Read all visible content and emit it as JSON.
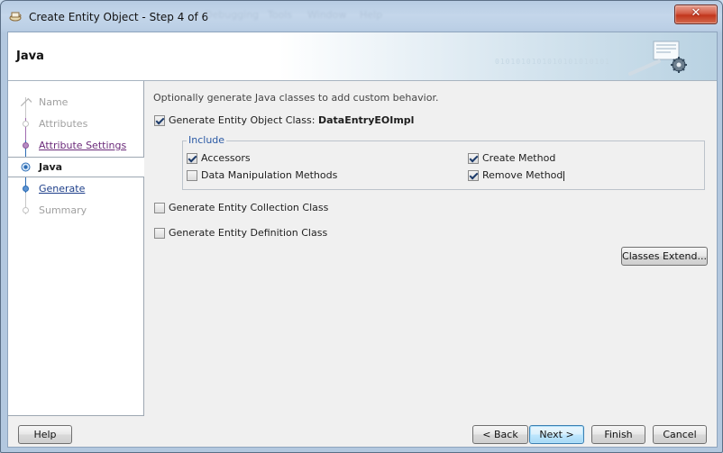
{
  "window": {
    "title": "Create Entity Object - Step 4 of 6",
    "ghost_menu": [
      "Debugging",
      "Tools",
      "Window",
      "Help"
    ]
  },
  "header": {
    "title": "Java",
    "binary_text": "0101010101010101010101"
  },
  "steps": [
    {
      "label": "Name",
      "state": "disabled"
    },
    {
      "label": "Attributes",
      "state": "disabled"
    },
    {
      "label": "Attribute Settings",
      "state": "visited"
    },
    {
      "label": "Java",
      "state": "current"
    },
    {
      "label": "Generate",
      "state": "link"
    },
    {
      "label": "Summary",
      "state": "disabled"
    }
  ],
  "content": {
    "description": "Optionally generate Java classes to add custom behavior.",
    "entity_object_class": {
      "label": "Generate Entity Object Class: ",
      "class_name": "DataEntryEOImpl",
      "checked": true
    },
    "include_group": {
      "title": "Include",
      "accessors": {
        "label": "Accessors",
        "checked": true
      },
      "data_manipulation": {
        "label": "Data Manipulation Methods",
        "checked": false
      },
      "create_method": {
        "label": "Create Method",
        "checked": true
      },
      "remove_method": {
        "label": "Remove Method",
        "checked": true
      }
    },
    "collection_class": {
      "label": "Generate Entity Collection Class",
      "checked": false
    },
    "definition_class": {
      "label": "Generate Entity Definition Class",
      "checked": false
    },
    "classes_extend_label": "Classes Extend..."
  },
  "footer": {
    "help_label": "Help",
    "back_label": "< Back",
    "next_label": "Next >",
    "finish_label": "Finish",
    "cancel_label": "Cancel"
  },
  "colors": {
    "title_bar": "#b7cce3",
    "close_button": "#c2351c",
    "group_title": "#2b5aa5",
    "visited_link": "#6b2a7a",
    "link": "#1e3f8a",
    "disabled_text": "#a0a0a0"
  }
}
